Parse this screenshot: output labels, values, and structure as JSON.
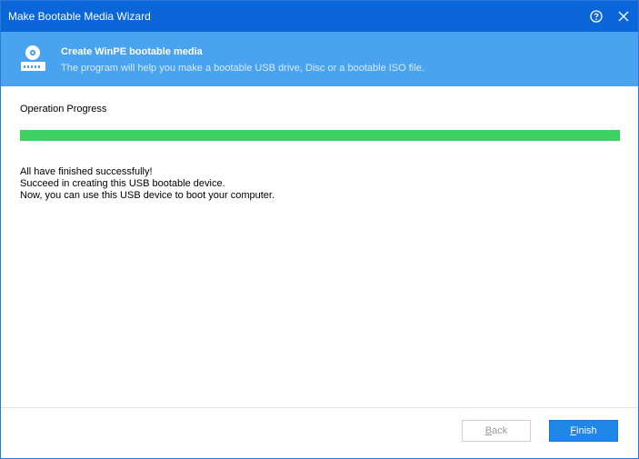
{
  "window": {
    "title": "Make Bootable Media Wizard"
  },
  "header": {
    "title": "Create WinPE bootable media",
    "subtitle": "The program will help you make a bootable USB drive, Disc or a bootable ISO file.",
    "icon": "drive-icon"
  },
  "content": {
    "progress_label": "Operation Progress",
    "progress_value": 1.0,
    "messages": [
      "All have finished successfully!",
      "Succeed in creating this USB bootable device.",
      "Now, you can use this USB device to boot your computer."
    ]
  },
  "footer": {
    "back_mnemonic": "B",
    "back_rest": "ack",
    "finish_mnemonic": "F",
    "finish_rest": "inish"
  },
  "colors": {
    "titlebar": "#0a66d9",
    "header": "#4aa3ee",
    "progress": "#3fd063",
    "primary_button": "#1f87e6"
  }
}
